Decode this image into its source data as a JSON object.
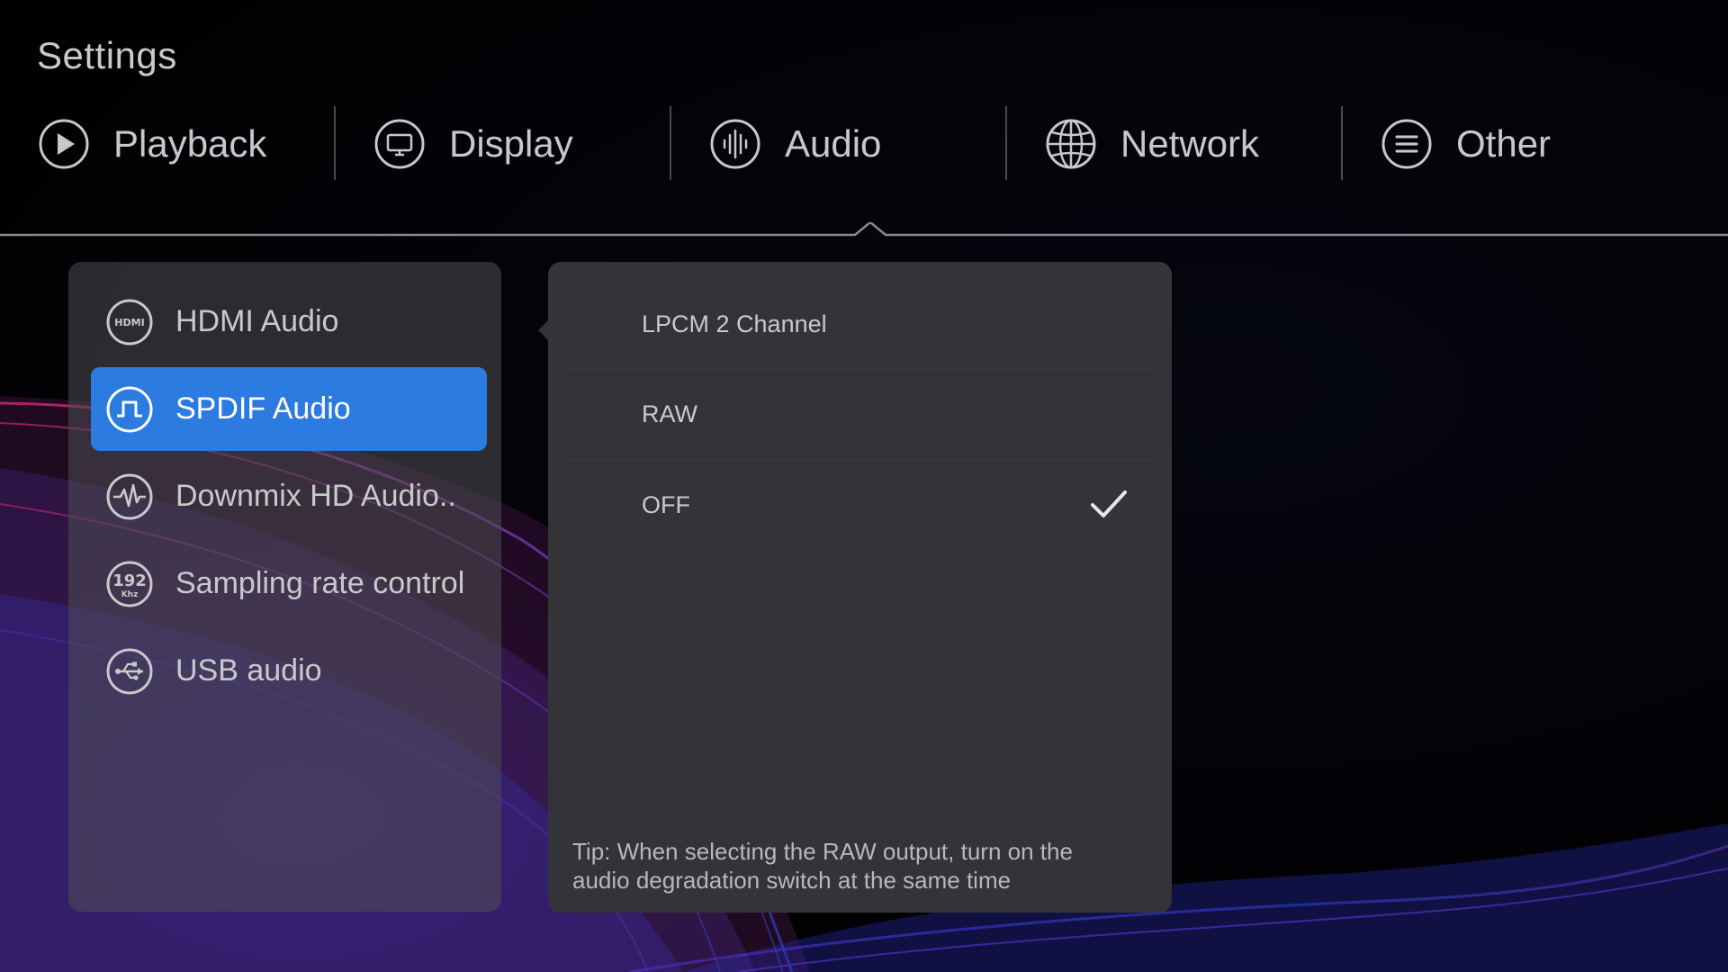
{
  "page": {
    "title": "Settings"
  },
  "tabs": [
    {
      "label": "Playback",
      "icon": "play-icon"
    },
    {
      "label": "Display",
      "icon": "monitor-icon"
    },
    {
      "label": "Audio",
      "icon": "audio-bars-icon",
      "active": true
    },
    {
      "label": "Network",
      "icon": "globe-icon"
    },
    {
      "label": "Other",
      "icon": "menu-lines-icon"
    }
  ],
  "menu": {
    "items": [
      {
        "label": "HDMI Audio",
        "icon": "hdmi-icon"
      },
      {
        "label": "SPDIF Audio",
        "icon": "square-wave-icon",
        "selected": true
      },
      {
        "label": "Downmix HD Audio..",
        "icon": "waveform-icon"
      },
      {
        "label": "Sampling rate control",
        "icon": "192-khz-icon",
        "icon_text_top": "192",
        "icon_text_bottom": "Khz"
      },
      {
        "label": "USB audio",
        "icon": "usb-icon"
      }
    ]
  },
  "options": {
    "items": [
      {
        "label": "LPCM 2 Channel",
        "checked": false
      },
      {
        "label": "RAW",
        "checked": false
      },
      {
        "label": "OFF",
        "checked": true
      }
    ],
    "tip": "Tip: When selecting the RAW output, turn on the audio degradation switch at the same time"
  },
  "colors": {
    "accent": "#2b7be0",
    "panel": "#343438",
    "text": "#c9c9cc",
    "wave_pink": "#c0246e",
    "wave_purple": "#7a3cc8",
    "wave_blue": "#2a4fd8"
  }
}
